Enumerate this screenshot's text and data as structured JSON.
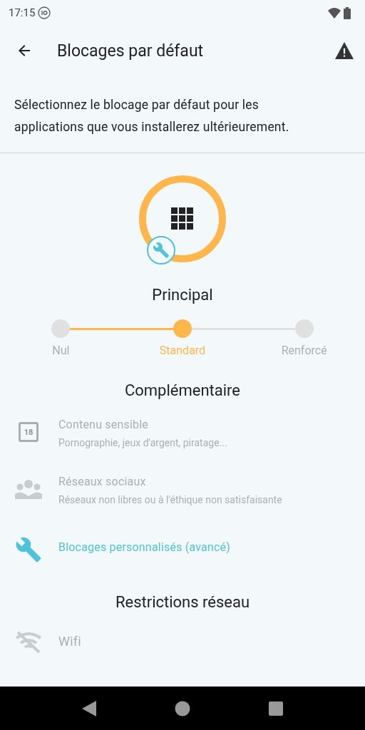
{
  "status_bar": {
    "time": "17:15"
  },
  "toolbar": {
    "title": "Blocages par défaut"
  },
  "description": "Sélectionnez le blocage par défaut pour les applications que vous installerez ultérieurement.",
  "principal": {
    "title": "Principal",
    "steps": [
      {
        "label": "Nul",
        "selected": false
      },
      {
        "label": "Standard",
        "selected": true
      },
      {
        "label": "Renforcé",
        "selected": false
      }
    ]
  },
  "complementaire": {
    "title": "Complémentaire",
    "items": [
      {
        "kind": "age",
        "icon_text": "18",
        "title": "Contenu sensible",
        "subtitle": "Pornographie, jeux d'argent, piratage...",
        "disabled": true
      },
      {
        "kind": "people",
        "title": "Réseaux sociaux",
        "subtitle": "Réseaux non libres ou à l'éthique non satisfaisante",
        "disabled": true
      },
      {
        "kind": "wrench",
        "title": "Blocages personnalisés (avancé)",
        "disabled": false
      }
    ]
  },
  "network": {
    "title": "Restrictions réseau",
    "items": [
      {
        "kind": "wifi-off",
        "title": "Wifi",
        "disabled": true
      }
    ]
  }
}
